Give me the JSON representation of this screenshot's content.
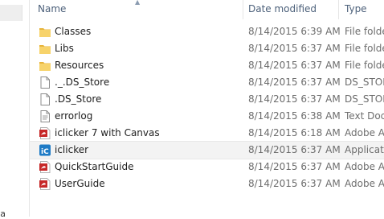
{
  "headers": {
    "name": "Name",
    "date_modified": "Date modified",
    "type": "Type"
  },
  "nav_fragment": "Ja",
  "colors": {
    "folder": "#f2c94c",
    "pdf": "#c62828",
    "app": "#1e7bc6",
    "header_text": "#4c607a"
  },
  "files": [
    {
      "name": "Classes",
      "date": "8/14/2015 6:39 AM",
      "type": "File folde",
      "icon": "folder-icon"
    },
    {
      "name": "Libs",
      "date": "8/14/2015 6:37 AM",
      "type": "File folde",
      "icon": "folder-icon"
    },
    {
      "name": "Resources",
      "date": "8/14/2015 6:37 AM",
      "type": "File folde",
      "icon": "folder-icon"
    },
    {
      "name": "._.DS_Store",
      "date": "8/14/2015 6:37 AM",
      "type": "DS_STOR",
      "icon": "blank-file-icon"
    },
    {
      "name": ".DS_Store",
      "date": "8/14/2015 6:37 AM",
      "type": "DS_STOR",
      "icon": "blank-file-icon"
    },
    {
      "name": "errorlog",
      "date": "8/14/2015 6:38 AM",
      "type": "Text Docu",
      "icon": "text-file-icon"
    },
    {
      "name": "iclicker 7 with Canvas",
      "date": "8/14/2015 6:18 AM",
      "type": "Adobe Ac",
      "icon": "pdf-icon"
    },
    {
      "name": "iclicker",
      "date": "8/14/2015 6:37 AM",
      "type": "Applicatio",
      "icon": "iclicker-app-icon"
    },
    {
      "name": "QuickStartGuide",
      "date": "8/14/2015 6:37 AM",
      "type": "Adobe Ac",
      "icon": "pdf-icon"
    },
    {
      "name": "UserGuide",
      "date": "8/14/2015 6:37 AM",
      "type": "Adobe Ac",
      "icon": "pdf-icon"
    }
  ]
}
